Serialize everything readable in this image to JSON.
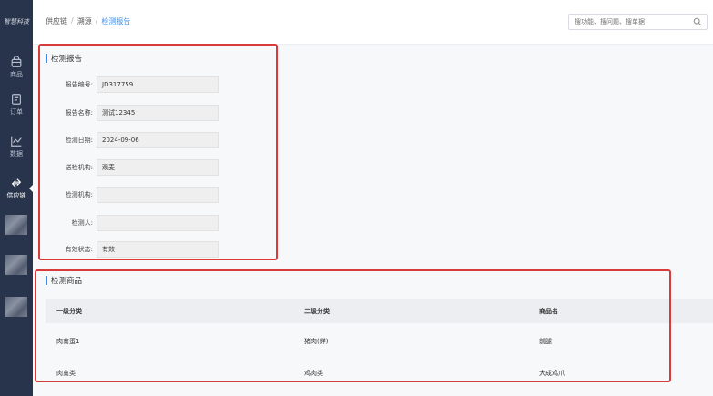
{
  "sidebar": {
    "logo": "智慧科技",
    "items": [
      {
        "label": "商品",
        "icon": "bag-icon"
      },
      {
        "label": "订单",
        "icon": "document-icon"
      },
      {
        "label": "数据",
        "icon": "chart-line-icon"
      },
      {
        "label": "供应链",
        "icon": "exchange-icon",
        "active": true
      }
    ]
  },
  "header": {
    "breadcrumb": [
      "供应链",
      "溯源",
      "检测报告"
    ],
    "search_placeholder": "搜功能、搜问题、搜单据"
  },
  "report": {
    "title": "检测报告",
    "fields": [
      {
        "label": "报告编号:",
        "value": "JD317759"
      },
      {
        "label": "报告名称:",
        "value": "测试12345"
      },
      {
        "label": "检测日期:",
        "value": "2024-09-06"
      },
      {
        "label": "送检机构:",
        "value": "观麦"
      },
      {
        "label": "检测机构:",
        "value": ""
      },
      {
        "label": "检测人:",
        "value": ""
      },
      {
        "label": "有效状态:",
        "value": "有效"
      }
    ]
  },
  "products": {
    "title": "检测商品",
    "columns": [
      "一级分类",
      "二级分类",
      "商品名"
    ],
    "rows": [
      [
        "肉禽蛋1",
        "猪肉(鲜)",
        "前腿"
      ],
      [
        "肉禽类",
        "鸡肉类",
        "大成鸡爪"
      ]
    ]
  },
  "colors": {
    "sidebar_bg": "#28344b",
    "accent": "#3b8beb",
    "highlight_box": "#d93a3a"
  }
}
